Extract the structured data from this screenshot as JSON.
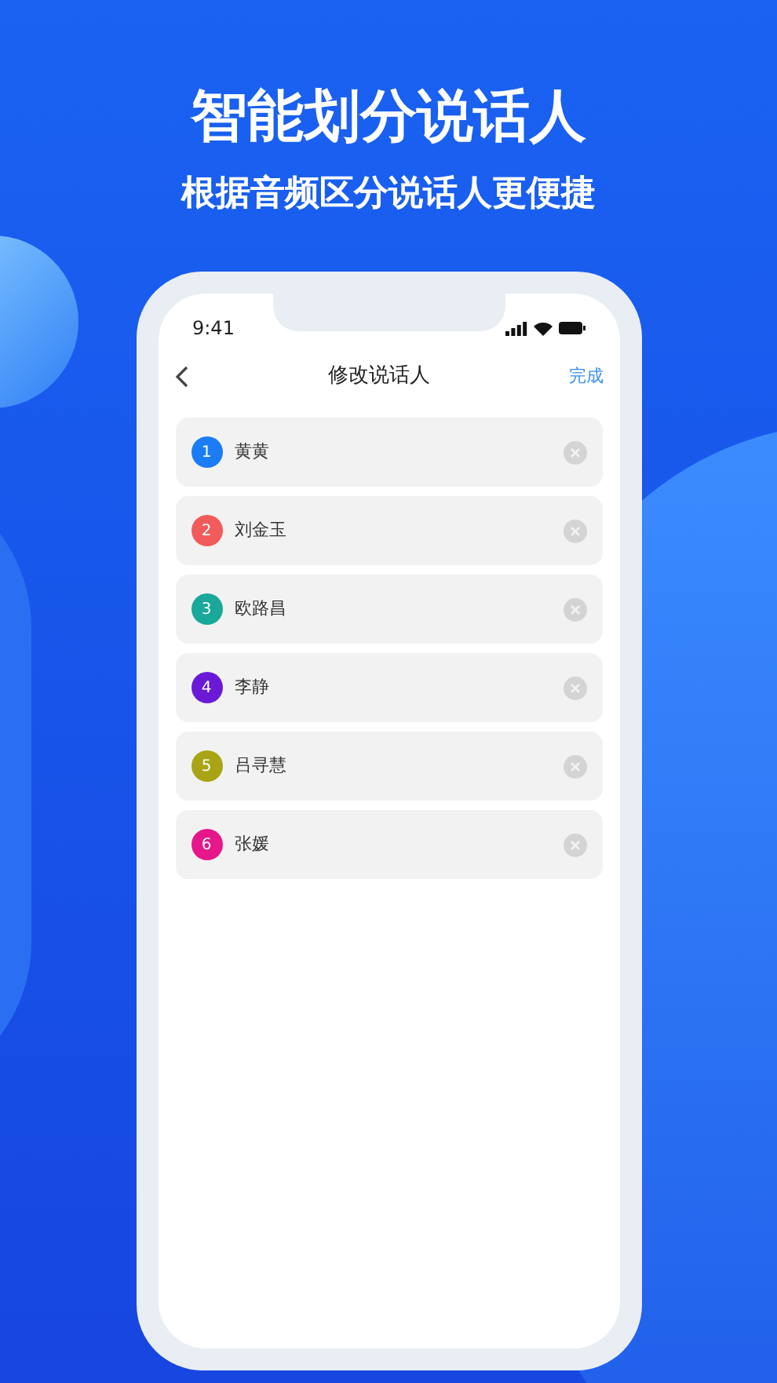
{
  "headline": "智能划分说话人",
  "subtitle": "根据音频区分说话人更便捷",
  "phone": {
    "status_bar": {
      "time": "9:41"
    },
    "nav": {
      "title": "修改说话人",
      "done": "完成"
    },
    "speakers": [
      {
        "number": "1",
        "name": "黄黄",
        "color": "#1b7cf5"
      },
      {
        "number": "2",
        "name": "刘金玉",
        "color": "#f25b5b"
      },
      {
        "number": "3",
        "name": "欧路昌",
        "color": "#1aa89a"
      },
      {
        "number": "4",
        "name": "李静",
        "color": "#6a1ad6"
      },
      {
        "number": "5",
        "name": "吕寻慧",
        "color": "#a8a415"
      },
      {
        "number": "6",
        "name": "张媛",
        "color": "#e5178a"
      }
    ]
  }
}
